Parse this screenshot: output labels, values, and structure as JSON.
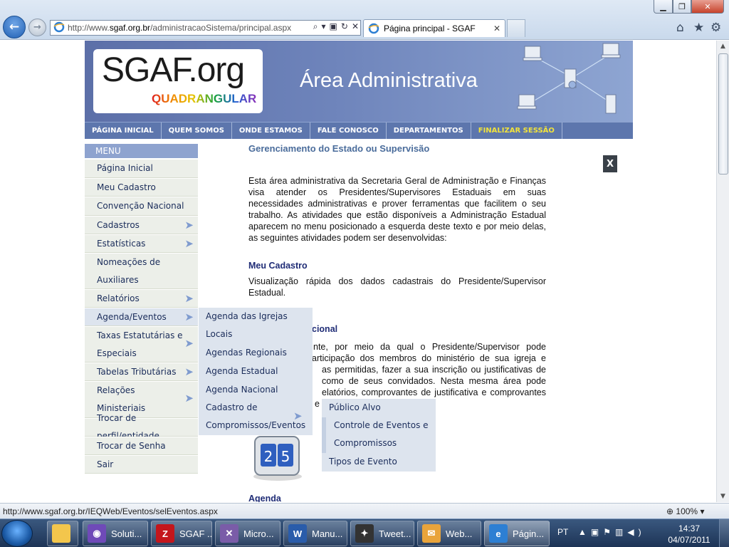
{
  "browser": {
    "address_prefix": "http://www.",
    "address_host": "sgaf.org.br",
    "address_path": "/administracaoSistema/principal.aspx",
    "tab_title": "Página principal - SGAF",
    "status_url": "http://www.sgaf.org.br/IEQWeb/Eventos/selEventos.aspx",
    "zoom": "100%"
  },
  "site": {
    "logo_main": "SGAF.org",
    "logo_sub": "QUADRANGULAR",
    "area_title": "Área Administrativa",
    "topnav": [
      "PÁGINA INICIAL",
      "QUEM SOMOS",
      "ONDE ESTAMOS",
      "FALE CONOSCO",
      "DEPARTAMENTOS",
      "FINALIZAR SESSÃO"
    ]
  },
  "menu": {
    "heading": "MENU",
    "items": [
      {
        "label": "Página Inicial"
      },
      {
        "label": "Meu Cadastro"
      },
      {
        "label": "Convenção Nacional"
      },
      {
        "label": "Cadastros"
      },
      {
        "label": "Estatísticas"
      },
      {
        "label": "Nomeações de"
      },
      {
        "label": "Auxiliares"
      },
      {
        "label": "Relatórios"
      },
      {
        "label": "Agenda/Eventos"
      },
      {
        "label": "Taxas Estatutárias e"
      },
      {
        "label": "Especiais"
      },
      {
        "label": "Tabelas Tributárias"
      },
      {
        "label": "Relações"
      },
      {
        "label": "Ministeriais"
      },
      {
        "label": "Trocar de perfil/entidade"
      },
      {
        "label": "Trocar de Senha"
      },
      {
        "label": "Sair"
      }
    ]
  },
  "flyout_agenda": {
    "items": [
      "Agenda das Igrejas",
      "Locais",
      "Agendas Regionais",
      "Agenda Estadual",
      "Agenda Nacional",
      "Cadastro de",
      "Compromissos/Eventos"
    ]
  },
  "flyout_cadastro": {
    "items": [
      "Público Alvo",
      "Controle de Eventos e",
      "Compromissos",
      "Tipos de Evento"
    ]
  },
  "content": {
    "title": "Gerenciamento do Estado ou Supervisão",
    "intro": "Esta área administrativa da Secretaria Geral de Administração e Finanças visa atender os Presidentes/Supervisores Estaduais em suas necessidades administrativas e prover ferramentas que facilitem o seu trabalho. As atividades que estão disponíveis a Administração Estadual aparecem no menu posicionado a esquerda deste texto e por meio delas, as seguintes atividades podem ser desenvolvidas:",
    "section1_title": "Meu Cadastro",
    "section1_text": "Visualização rápida dos dados cadastrais do Presidente/Supervisor Estadual.",
    "section2_title_visible": "cional",
    "section2_lines": [
      "nte, por meio da qual o Presidente/Supervisor pode",
      "articipação dos membros do ministério de sua igreja e",
      "as permitidas, fazer a sua inscrição ou justificativas de",
      "como de seus convidados. Nesta mesma área pode",
      "elatórios, comprovantes de justificativa e comprovantes",
      "e"
    ],
    "section3_title": "Agenda",
    "calendar_day": "25",
    "close_label": "X"
  },
  "taskbar": {
    "buttons": [
      {
        "label": "Soluti...",
        "icon": "crystal-ball-icon"
      },
      {
        "label": "SGAF ...",
        "icon": "filezilla-icon"
      },
      {
        "label": "Micro...",
        "icon": "visual-studio-icon"
      },
      {
        "label": "Manu...",
        "icon": "word-icon"
      },
      {
        "label": "Tweet...",
        "icon": "bird-icon"
      },
      {
        "label": "Web...",
        "icon": "outlook-icon"
      },
      {
        "label": "Págin...",
        "icon": "internet-explorer-icon"
      }
    ],
    "lang": "PT",
    "time": "14:37",
    "date": "04/07/2011"
  },
  "colors": {
    "header_blue": "#6e84bb",
    "nav_blue": "#5d76ad",
    "menu_bg": "#ecefe9",
    "flyout_bg": "#dde4ee",
    "title_blue": "#4a6c9b",
    "subhead_navy": "#1f2c76",
    "finalizar_yellow": "#f2e33a"
  }
}
